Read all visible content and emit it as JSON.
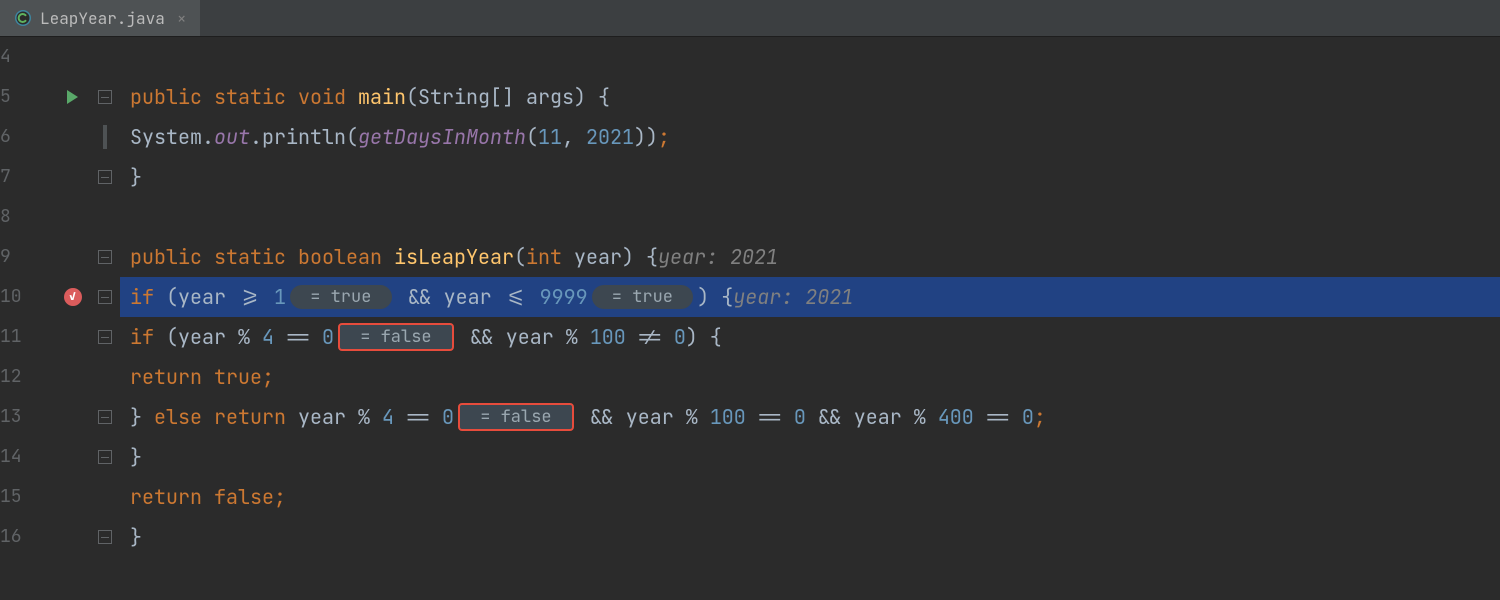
{
  "tab": {
    "filename": "LeapYear.java"
  },
  "gutter": {
    "lines": [
      "4",
      "5",
      "6",
      "7",
      "8",
      "9",
      "10",
      "11",
      "12",
      "13",
      "14",
      "15",
      "16"
    ]
  },
  "code": {
    "l5": {
      "kw1": "public ",
      "kw2": "static ",
      "kw3": "void ",
      "fn": "main",
      "p1": "(String[] args) {"
    },
    "l6": {
      "t1": "System.",
      "out": "out",
      "t2": ".println(",
      "fn": "getDaysInMonth",
      "p1": "(",
      "n1": "11",
      "c": ", ",
      "n2": "2021",
      "p2": "))",
      "semi": ";"
    },
    "l7": {
      "brace": "}"
    },
    "l9": {
      "kw1": "public ",
      "kw2": "static ",
      "kw3": "boolean ",
      "fn": "isLeapYear",
      "p1": "(",
      "kw4": "int ",
      "id": "year",
      "p2": ") {",
      "hint": "year: 2021"
    },
    "l10": {
      "kw1": "if ",
      "p1": "(year >= ",
      "n1": "1",
      "pill1": " = true ",
      "op1": " && year <= ",
      "n2": "9999",
      "pill2": " = true ",
      "p2": ") {",
      "hint": "year: 2021"
    },
    "l11": {
      "kw1": "if ",
      "p1": "(year % ",
      "n1": "4 ",
      "op1": "== ",
      "n2": "0",
      "pill1": " = false ",
      "op2": " && year % ",
      "n3": "100 ",
      "op3": "!= ",
      "n4": "0",
      "p2": ") {"
    },
    "l12": {
      "kw1": "return ",
      "b1": "true",
      "semi": ";"
    },
    "l13": {
      "brace": "} ",
      "kw1": "else ",
      "kw2": "return ",
      "t1": "year % ",
      "n1": "4 ",
      "op1": "== ",
      "n2": "0",
      "pill1": " = false ",
      "op2": " && year % ",
      "n3": "100 ",
      "op3": "== ",
      "n4": "0 ",
      "op4": "&& year % ",
      "n5": "400 ",
      "op5": "== ",
      "n6": "0",
      "semi": ";"
    },
    "l14": {
      "brace": "}"
    },
    "l15": {
      "kw1": "return ",
      "b1": "false",
      "semi": ";"
    },
    "l16": {
      "brace": "}"
    }
  }
}
